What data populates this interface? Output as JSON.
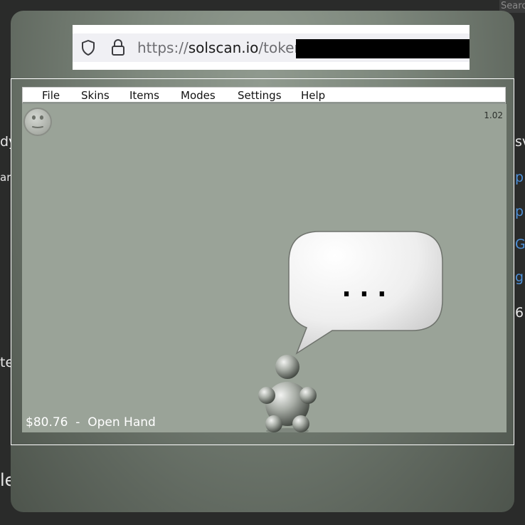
{
  "browser": {
    "url_scheme": "https://",
    "url_host": "solscan.io",
    "url_path": "/token/"
  },
  "game": {
    "menu": [
      "File",
      "Skins",
      "Items",
      "Modes",
      "Settings",
      "Help"
    ],
    "version": "1.02",
    "speech_text": "...",
    "balance": "$80.76",
    "separator": "-",
    "mode": "Open Hand"
  },
  "background_page": {
    "search": "Searc",
    "left_fragments": [
      "dy",
      "ary",
      "te",
      "le"
    ],
    "right_fragments": [
      "sv",
      "p",
      "p",
      "G",
      "g",
      "6"
    ]
  },
  "colors": {
    "canvas": "#9aa398",
    "modal": "#7e887d",
    "link": "#4d8fd6"
  }
}
